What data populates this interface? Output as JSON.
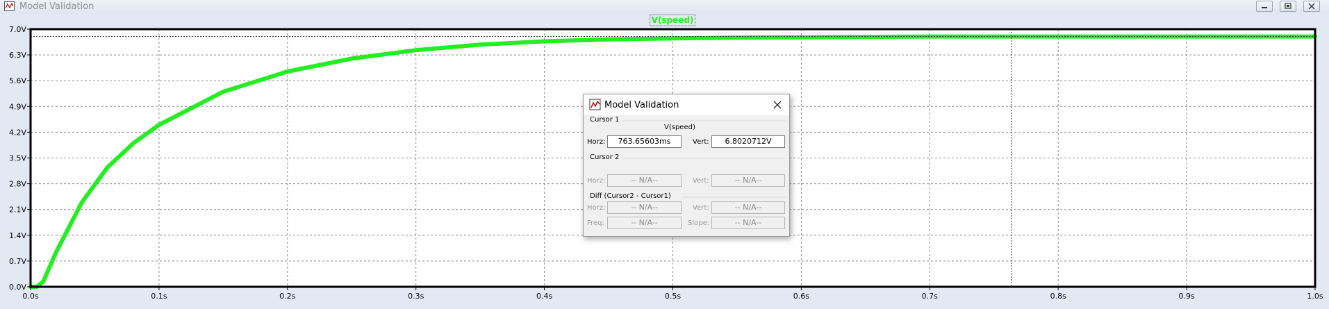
{
  "window": {
    "title": "Model Validation",
    "icon": "waveform-viewer-icon"
  },
  "window_controls": [
    "minimize-icon",
    "restore-icon",
    "close-icon"
  ],
  "chart_data": {
    "type": "line",
    "legend": "V(speed)",
    "series": [
      {
        "name": "V(speed)",
        "color": "#22ee22",
        "x": [
          0,
          0.005,
          0.01,
          0.02,
          0.04,
          0.06,
          0.08,
          0.1,
          0.15,
          0.2,
          0.25,
          0.3,
          0.35,
          0.4,
          0.45,
          0.5,
          0.55,
          0.6,
          0.65,
          0.7,
          0.75,
          0.8,
          0.85,
          0.9,
          0.95,
          1.0
        ],
        "y": [
          0,
          0,
          0.15,
          0.95,
          2.3,
          3.25,
          3.9,
          4.4,
          5.3,
          5.85,
          6.2,
          6.43,
          6.58,
          6.67,
          6.72,
          6.75,
          6.77,
          6.78,
          6.79,
          6.8,
          6.8,
          6.8,
          6.8,
          6.8,
          6.8,
          6.8
        ]
      }
    ],
    "xlim": [
      0,
      1.0
    ],
    "ylim": [
      0,
      7.0
    ],
    "x_ticks": [
      "0.0s",
      "0.1s",
      "0.2s",
      "0.3s",
      "0.4s",
      "0.5s",
      "0.6s",
      "0.7s",
      "0.8s",
      "0.9s",
      "1.0s"
    ],
    "y_ticks": [
      "0.0V",
      "0.7V",
      "1.4V",
      "2.1V",
      "2.8V",
      "3.5V",
      "4.2V",
      "4.9V",
      "5.6V",
      "6.3V",
      "7.0V"
    ],
    "grid": true,
    "cursor": {
      "x": 0.76365603,
      "y": 6.8020712
    }
  },
  "dialog": {
    "title": "Model Validation",
    "cursor1": {
      "heading": "Cursor 1",
      "trace": "V(speed)",
      "horz_label": "Horz:",
      "horz_value": "763.65603ms",
      "vert_label": "Vert:",
      "vert_value": "6.8020712V"
    },
    "cursor2": {
      "heading": "Cursor 2",
      "horz_label": "Horz:",
      "horz_value": "-- N/A--",
      "vert_label": "Vert:",
      "vert_value": "-- N/A--"
    },
    "diff": {
      "heading": "Diff (Cursor2 - Cursor1)",
      "horz_label": "Horz:",
      "horz_value": "-- N/A--",
      "vert_label": "Vert:",
      "vert_value": "-- N/A--",
      "freq_label": "Freq:",
      "freq_value": "-- N/A--",
      "slope_label": "Slope:",
      "slope_value": "-- N/A--"
    }
  }
}
